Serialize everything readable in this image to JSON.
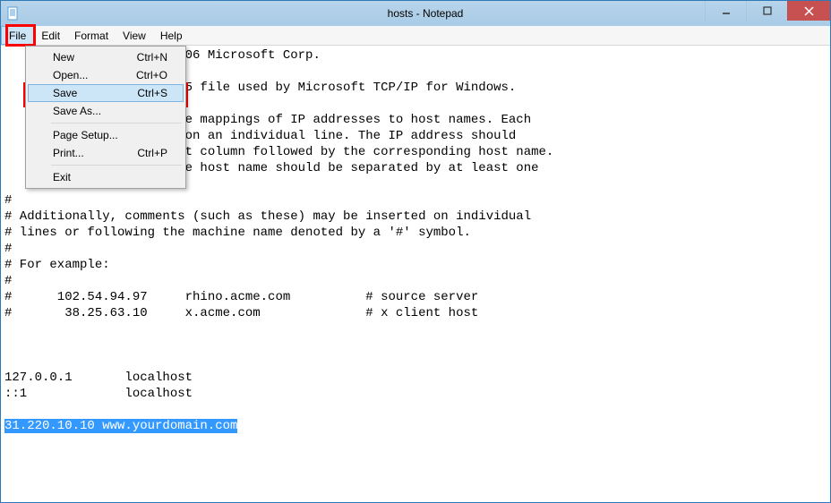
{
  "window": {
    "title": "hosts - Notepad"
  },
  "menubar": {
    "file": "File",
    "edit": "Edit",
    "format": "Format",
    "view": "View",
    "help": "Help"
  },
  "filemenu": {
    "new_label": "New",
    "new_sc": "Ctrl+N",
    "open_label": "Open...",
    "open_sc": "Ctrl+O",
    "save_label": "Save",
    "save_sc": "Ctrl+S",
    "saveas_label": "Save As...",
    "pagesetup_label": "Page Setup...",
    "print_label": "Print...",
    "print_sc": "Ctrl+P",
    "exit_label": "Exit"
  },
  "content": {
    "line01": "                        06 Microsoft Corp.",
    "line02": "",
    "line03": "                        5 file used by Microsoft TCP/IP for Windows.",
    "line04": "",
    "line05": "                        e mappings of IP addresses to host names. Each",
    "line06": "                        on an individual line. The IP address should",
    "line07": "                        t column followed by the corresponding host name.",
    "line08": "                        e host name should be separated by at least one",
    "line09": "",
    "line10": "#",
    "line11": "# Additionally, comments (such as these) may be inserted on individual",
    "line12": "# lines or following the machine name denoted by a '#' symbol.",
    "line13": "#",
    "line14": "# For example:",
    "line15": "#",
    "line16": "#      102.54.94.97     rhino.acme.com          # source server",
    "line17": "#       38.25.63.10     x.acme.com              # x client host",
    "line18": "",
    "line19": "",
    "line20": "",
    "line21": "127.0.0.1       localhost",
    "line22": "::1             localhost",
    "line23": "",
    "selected": "31.220.10.10 www.yourdomain.com"
  }
}
